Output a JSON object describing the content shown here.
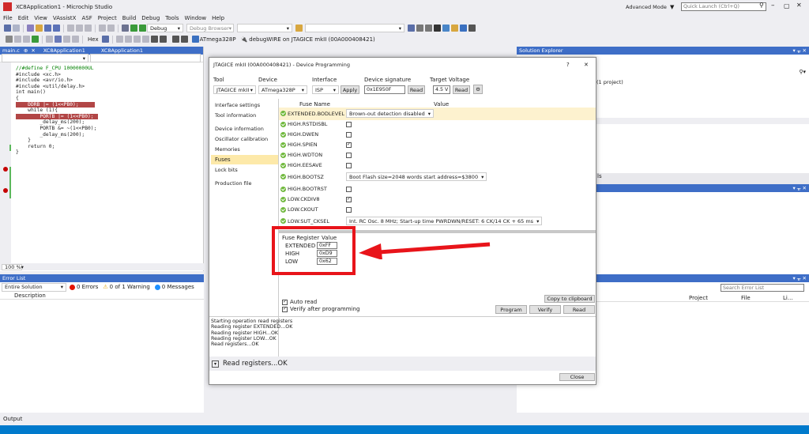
{
  "window": {
    "title": "XC8Application1 - Microchip Studio",
    "mode": "Advanced Mode",
    "quick_launch": "Quick Launch (Ctrl+Q)"
  },
  "menu": [
    "File",
    "Edit",
    "View",
    "VAssistX",
    "ASF",
    "Project",
    "Build",
    "Debug",
    "Tools",
    "Window",
    "Help"
  ],
  "toolbar": {
    "config": "Debug",
    "browser": "Debug Browser",
    "hex": "Hex",
    "device": "ATmega328P",
    "debugger": "debugWIRE on JTAGICE mkII (00A000408421)"
  },
  "tabs": {
    "file": "main.c",
    "project": "XC8Application1",
    "project2": "XC8Application1"
  },
  "code": [
    "//#define F_CPU 10000000UL",
    "",
    "#include <xc.h>",
    "#include <avr/io.h>",
    "#include <util/delay.h>",
    "",
    "int main()",
    "{",
    "    DDRB |= (1<<PB0);",
    "",
    "    while (1){",
    "        PORTB |= (1<<PB0);",
    "        _delay_ms(200);",
    "        PORTB &= ~(1<<PB0);",
    "        _delay_ms(200);",
    "    }",
    "    return 0;",
    "}"
  ],
  "zoom": "100 %",
  "error_list": {
    "title": "Error List",
    "scope": "Entire Solution",
    "errors": "0 Errors",
    "warnings": "0 of 1 Warning",
    "messages": "0 Messages",
    "col_description": "Description",
    "col_project": "Project",
    "col_file": "File",
    "col_line": "Li...",
    "search": "Search Error List"
  },
  "solution_explorer": {
    "title": "Solution Explorer",
    "item": "(1 project)",
    "snippet": "ls"
  },
  "output": {
    "title": "Output"
  },
  "dialog": {
    "title": "JTAGICE mkII (00A000408421) - Device Programming",
    "help": "?",
    "close": "✕",
    "labels": {
      "tool": "Tool",
      "device": "Device",
      "interface": "Interface",
      "signature": "Device signature",
      "voltage": "Target Voltage"
    },
    "values": {
      "tool": "JTAGICE mkII",
      "device": "ATmega328P",
      "interface": "ISP",
      "signature": "0x1E950F",
      "voltage": "4.5 V"
    },
    "apply": "Apply",
    "read": "Read",
    "read2": "Read",
    "nav": [
      "Interface settings",
      "Tool information",
      "Device information",
      "Oscillator calibration",
      "Memories",
      "Fuses",
      "Lock bits",
      "Production file"
    ],
    "fuse_header": {
      "name": "Fuse Name",
      "value": "Value"
    },
    "fuses": [
      {
        "name": "EXTENDED.BODLEVEL",
        "value": "Brown-out detection disabled",
        "kind": "select"
      },
      {
        "name": "HIGH.RSTDISBL",
        "value": "",
        "kind": "check",
        "checked": false
      },
      {
        "name": "HIGH.DWEN",
        "value": "",
        "kind": "check",
        "checked": false
      },
      {
        "name": "HIGH.SPIEN",
        "value": "",
        "kind": "check",
        "checked": true
      },
      {
        "name": "HIGH.WDTON",
        "value": "",
        "kind": "check",
        "checked": false
      },
      {
        "name": "HIGH.EESAVE",
        "value": "",
        "kind": "check",
        "checked": false
      },
      {
        "name": "HIGH.BOOTSZ",
        "value": "Boot Flash size=2048 words start address=$3800",
        "kind": "select"
      },
      {
        "name": "HIGH.BOOTRST",
        "value": "",
        "kind": "check",
        "checked": false
      },
      {
        "name": "LOW.CKDIV8",
        "value": "",
        "kind": "check",
        "checked": true
      },
      {
        "name": "LOW.CKOUT",
        "value": "",
        "kind": "check",
        "checked": false
      },
      {
        "name": "LOW.SUT_CKSEL",
        "value": "Int. RC Osc. 8 MHz; Start-up time PWRDWN/RESET: 6 CK/14 CK + 65 ms",
        "kind": "select"
      }
    ],
    "register_header": {
      "name": "Fuse Register",
      "value": "Value"
    },
    "registers": [
      {
        "name": "EXTENDED",
        "value": "0xFF"
      },
      {
        "name": "HIGH",
        "value": "0xD9"
      },
      {
        "name": "LOW",
        "value": "0x62"
      }
    ],
    "copy": "Copy to clipboard",
    "auto_read": "Auto read",
    "verify_after": "Verify after programming",
    "program": "Program",
    "verify": "Verify",
    "read_btn": "Read",
    "log": [
      "Starting operation read registers",
      "Reading register EXTENDED...OK",
      "Reading register HIGH...OK",
      "Reading register LOW...OK",
      "Read registers...OK"
    ],
    "status": "Read registers...OK",
    "close_btn": "Close"
  },
  "colors": {
    "accent": "#007acc",
    "selection": "#3e6ec7",
    "breakpoint": "#c50000",
    "arrow": "#e8141a"
  }
}
